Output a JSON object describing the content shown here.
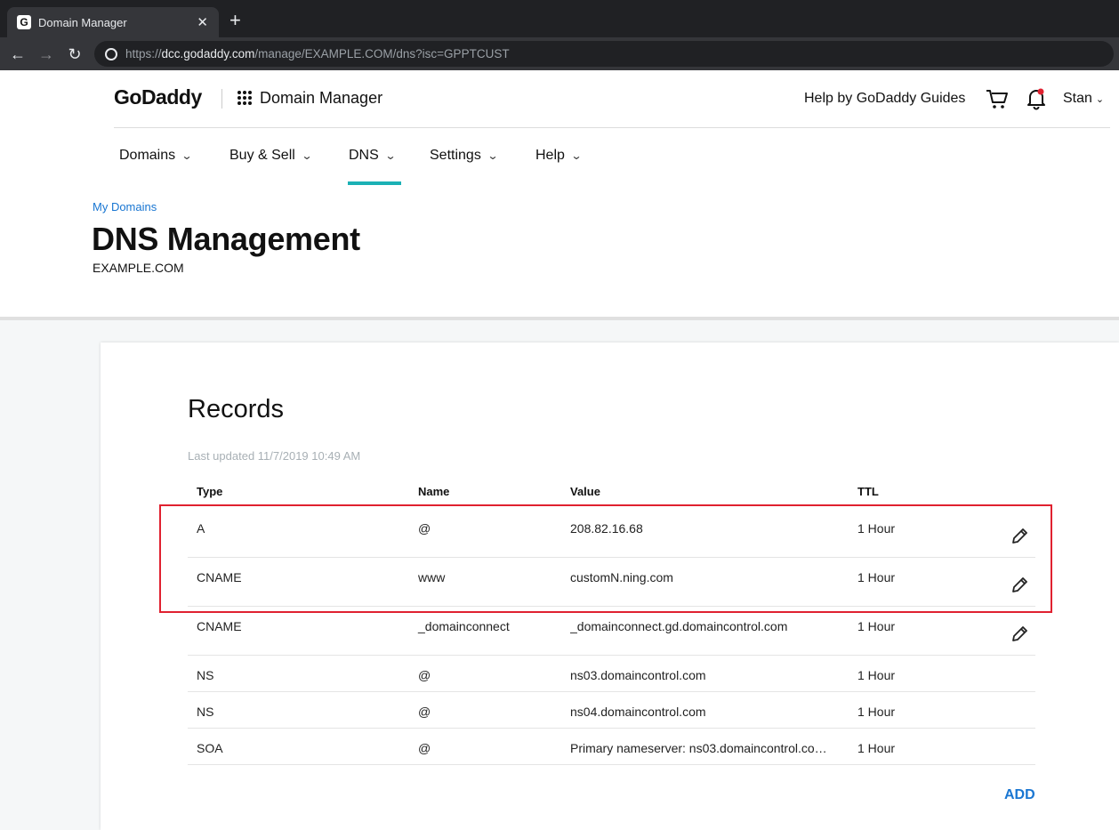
{
  "browser": {
    "tab_title": "Domain Manager",
    "favicon_letter": "G",
    "url_prefix": "https://",
    "url_host": "dcc.godaddy.com",
    "url_path": "/manage/EXAMPLE.COM/dns?isc=GPPTCUST"
  },
  "header": {
    "logo": "GoDaddy",
    "product": "Domain Manager",
    "help_link": "Help by GoDaddy Guides",
    "user": "Stan"
  },
  "nav": {
    "domains": "Domains",
    "buysell": "Buy & Sell",
    "dns": "DNS",
    "settings": "Settings",
    "help": "Help"
  },
  "page": {
    "breadcrumb": "My Domains",
    "title": "DNS Management",
    "subtitle": "EXAMPLE.COM"
  },
  "records": {
    "title": "Records",
    "last_updated": "Last updated 11/7/2019 10:49 AM",
    "headers": {
      "type": "Type",
      "name": "Name",
      "value": "Value",
      "ttl": "TTL"
    },
    "rows": [
      {
        "type": "A",
        "name": "@",
        "value": "208.82.16.68",
        "ttl": "1 Hour",
        "editable": true
      },
      {
        "type": "CNAME",
        "name": "www",
        "value": "customN.ning.com",
        "ttl": "1 Hour",
        "editable": true
      },
      {
        "type": "CNAME",
        "name": "_domainconnect",
        "value": "_domainconnect.gd.domaincontrol.com",
        "ttl": "1 Hour",
        "editable": true
      },
      {
        "type": "NS",
        "name": "@",
        "value": "ns03.domaincontrol.com",
        "ttl": "1 Hour",
        "editable": false
      },
      {
        "type": "NS",
        "name": "@",
        "value": "ns04.domaincontrol.com",
        "ttl": "1 Hour",
        "editable": false
      },
      {
        "type": "SOA",
        "name": "@",
        "value": "Primary nameserver: ns03.domaincontrol.co…",
        "ttl": "1 Hour",
        "editable": false
      }
    ],
    "add_label": "ADD"
  },
  "colors": {
    "accent_teal": "#1bb1b5",
    "link_blue": "#1976d2",
    "highlight_red": "#e02130",
    "notification_red": "#e02130"
  }
}
